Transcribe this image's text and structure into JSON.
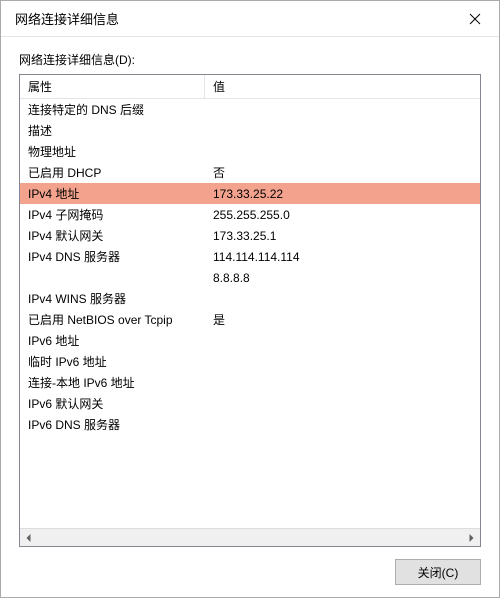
{
  "window": {
    "title": "网络连接详细信息"
  },
  "section": {
    "label": "网络连接详细信息(D):"
  },
  "columns": {
    "property": "属性",
    "value": "值"
  },
  "rows": [
    {
      "prop": "连接特定的 DNS 后缀",
      "val": ""
    },
    {
      "prop": "描述",
      "val": ""
    },
    {
      "prop": "物理地址",
      "val": ""
    },
    {
      "prop": "已启用 DHCP",
      "val": "否"
    },
    {
      "prop": "IPv4 地址",
      "val": "173.33.25.22",
      "highlight": true
    },
    {
      "prop": "IPv4 子网掩码",
      "val": "255.255.255.0"
    },
    {
      "prop": "IPv4 默认网关",
      "val": "173.33.25.1"
    },
    {
      "prop": "IPv4 DNS 服务器",
      "val": "114.114.114.114"
    },
    {
      "prop": "",
      "val": "8.8.8.8"
    },
    {
      "prop": "IPv4 WINS 服务器",
      "val": ""
    },
    {
      "prop": "已启用 NetBIOS over Tcpip",
      "val": "是"
    },
    {
      "prop": "IPv6 地址",
      "val": ""
    },
    {
      "prop": "临时 IPv6 地址",
      "val": ""
    },
    {
      "prop": "连接-本地 IPv6 地址",
      "val": ""
    },
    {
      "prop": "IPv6 默认网关",
      "val": ""
    },
    {
      "prop": "IPv6 DNS 服务器",
      "val": ""
    }
  ],
  "buttons": {
    "close": "关闭(C)"
  }
}
